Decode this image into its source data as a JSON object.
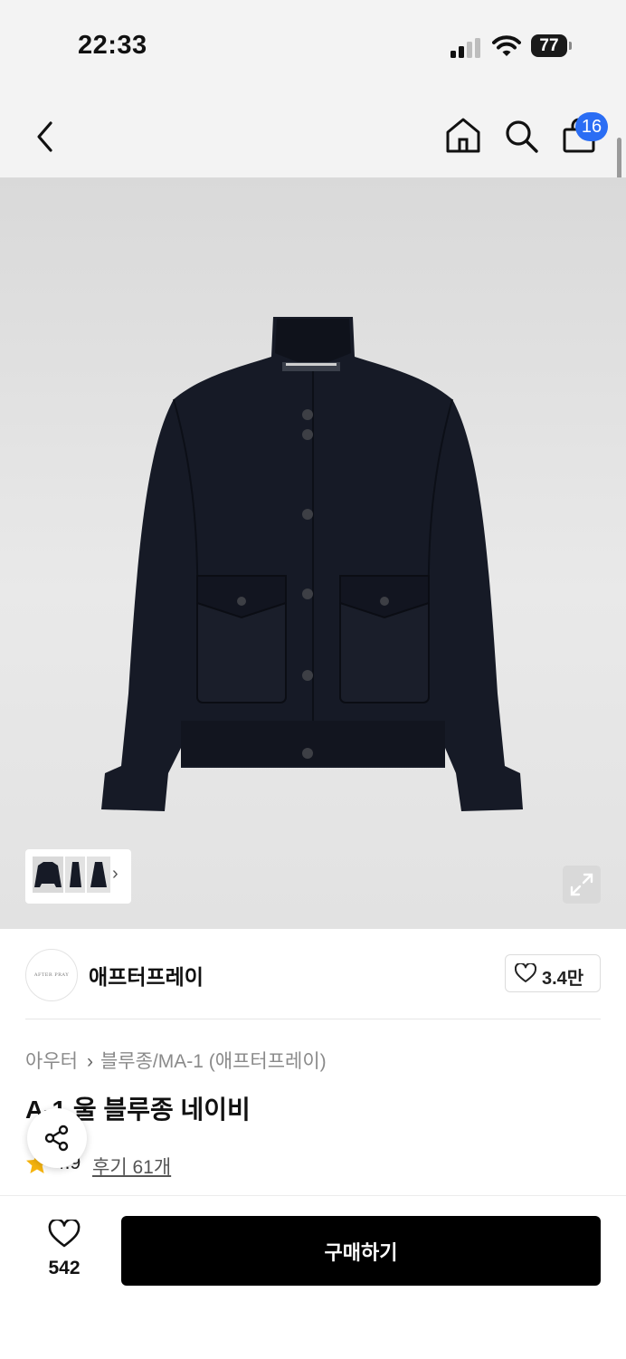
{
  "status_bar": {
    "time": "22:33",
    "battery": "77",
    "icons": [
      "signal-icon",
      "wifi-icon",
      "battery-icon"
    ]
  },
  "nav": {
    "icons": [
      "back-icon",
      "home-icon",
      "search-icon",
      "shopping-bag-icon"
    ],
    "cart_count": "16"
  },
  "gallery": {
    "thumbnail_count": 3,
    "icons": [
      "chevron-right-icon",
      "expand-icon"
    ]
  },
  "brand": {
    "logo_text": "AFTER PRAY",
    "name": "애프터프레이",
    "likes": "3.4만"
  },
  "product": {
    "breadcrumb": [
      "아우터",
      "블루종/MA-1 (애프터프레이)"
    ],
    "title": "A-1 울 블루종 네이비",
    "rating": "4.9",
    "reviews": "후기 61개"
  },
  "bottom_bar": {
    "wish_count": "542",
    "buy_label": "구매하기"
  },
  "colors": {
    "accent": "#2a6df4",
    "buy_button": "#000000",
    "star": "#f6b40e",
    "product_color": "#161a26"
  }
}
